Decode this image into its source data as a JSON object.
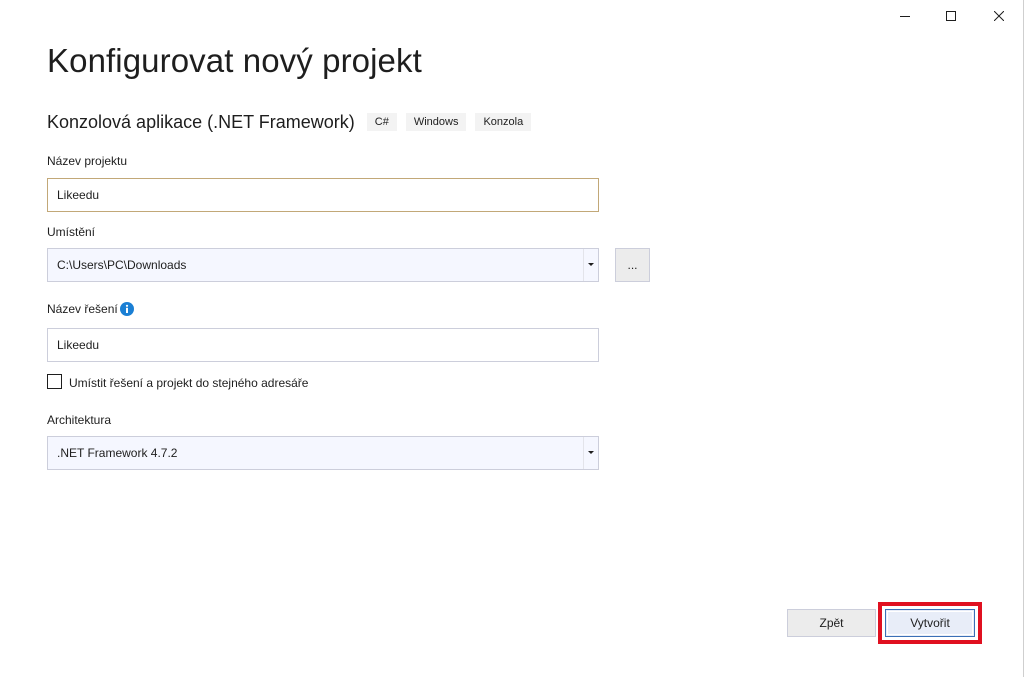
{
  "window": {
    "title": "Konfigurovat nový projekt",
    "template_name": "Konzolová aplikace (.NET Framework)",
    "tags": [
      "C#",
      "Windows",
      "Konzola"
    ]
  },
  "form": {
    "project_name": {
      "label": "Název projektu",
      "value": "Likeedu"
    },
    "location": {
      "label": "Umístění",
      "value": "C:\\Users\\PC\\Downloads",
      "browse_label": "..."
    },
    "solution_name": {
      "label": "Název řešení",
      "value": "Likeedu"
    },
    "same_directory": {
      "label": "Umístit řešení a projekt do stejného adresáře",
      "checked": false
    },
    "framework": {
      "label": "Architektura",
      "value": ".NET Framework 4.7.2"
    }
  },
  "footer": {
    "back_label": "Zpět",
    "create_label": "Vytvořit"
  },
  "colors": {
    "highlight": "#e01020",
    "info_icon": "#1a7fd4",
    "focus_border": "#c2a878"
  }
}
